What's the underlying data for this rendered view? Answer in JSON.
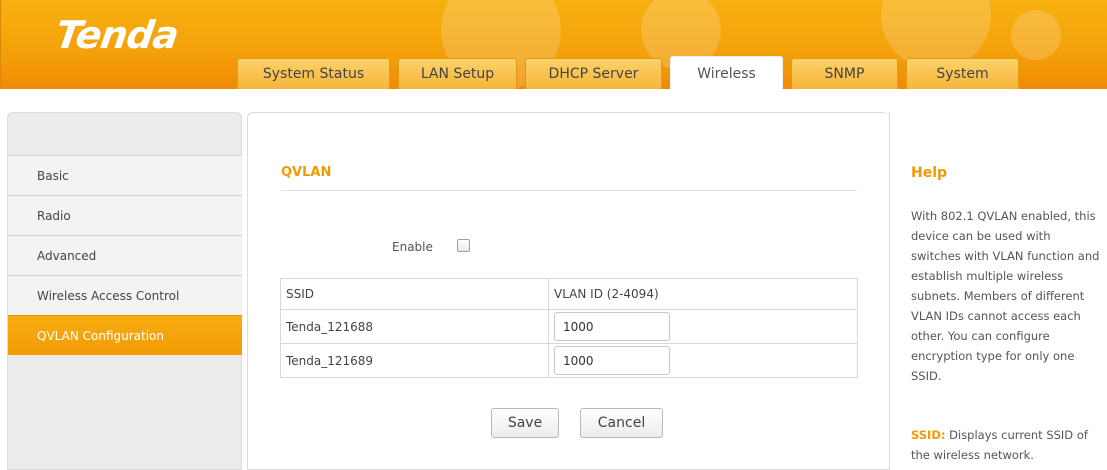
{
  "brand": {
    "logo": "Tenda"
  },
  "nav": {
    "tabs": [
      {
        "label": "System Status"
      },
      {
        "label": "LAN Setup"
      },
      {
        "label": "DHCP Server"
      },
      {
        "label": "Wireless",
        "active": true
      },
      {
        "label": "SNMP"
      },
      {
        "label": "System"
      }
    ]
  },
  "sidebar": {
    "items": [
      {
        "label": "Basic"
      },
      {
        "label": "Radio"
      },
      {
        "label": "Advanced"
      },
      {
        "label": "Wireless Access Control"
      },
      {
        "label": "QVLAN Configuration",
        "active": true
      }
    ]
  },
  "main": {
    "title": "QVLAN",
    "enable_label": "Enable",
    "enable_checked": false,
    "table": {
      "headers": [
        "SSID",
        "VLAN ID (2-4094)"
      ],
      "rows": [
        {
          "ssid": "Tenda_121688",
          "vlan_id": "1000"
        },
        {
          "ssid": "Tenda_121689",
          "vlan_id": "1000"
        }
      ]
    },
    "save_label": "Save",
    "cancel_label": "Cancel"
  },
  "help": {
    "title": "Help",
    "text": "With 802.1 QVLAN enabled, this device can be used with switches with VLAN function and establish multiple wireless subnets. Members of different VLAN IDs cannot access each other. You can configure encryption type for only one SSID.",
    "ssid_key": "SSID:",
    "ssid_text": " Displays current SSID of the wireless network."
  },
  "colors": {
    "accent": "#f39800",
    "header": "#f4a00a",
    "active_side": "#f5a30b"
  }
}
